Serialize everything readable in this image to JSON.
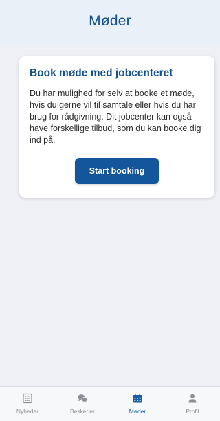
{
  "header": {
    "title": "Møder"
  },
  "card": {
    "title": "Book møde med jobcenteret",
    "body": "Du har mulighed for selv at booke et møde, hvis du gerne vil til samtale eller hvis du har brug for rådgivning. Dit jobcenter kan også have forskellige tilbud, som du kan booke dig ind på.",
    "button_label": "Start booking"
  },
  "tabbar": {
    "items": [
      {
        "label": "Nyheder",
        "icon": "news-icon"
      },
      {
        "label": "Beskeder",
        "icon": "messages-icon"
      },
      {
        "label": "Møder",
        "icon": "calendar-icon",
        "active": true
      },
      {
        "label": "Profil",
        "icon": "profile-icon"
      }
    ]
  },
  "colors": {
    "brand_blue": "#13508f",
    "button_blue": "#13569c",
    "background": "#eef0f5",
    "inactive_gray": "#8a8e95"
  }
}
